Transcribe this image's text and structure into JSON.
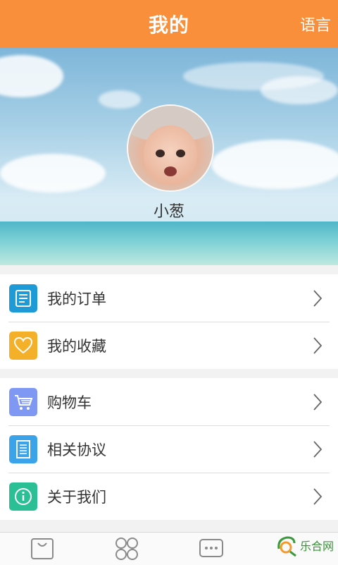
{
  "header": {
    "title": "我的",
    "language_label": "语言"
  },
  "profile": {
    "username": "小葱"
  },
  "menu_group_1": [
    {
      "label": "我的订单",
      "icon": "order-list-icon",
      "color": "#1e9bd7"
    },
    {
      "label": "我的收藏",
      "icon": "heart-icon",
      "color": "#f5b02a"
    }
  ],
  "menu_group_2": [
    {
      "label": "购物车",
      "icon": "cart-icon",
      "color": "#7f98f3"
    },
    {
      "label": "相关协议",
      "icon": "document-icon",
      "color": "#3aa3ea"
    },
    {
      "label": "关于我们",
      "icon": "info-icon",
      "color": "#2bbf96"
    }
  ],
  "tabbar": [
    {
      "name": "bag-icon"
    },
    {
      "name": "grid-icon"
    },
    {
      "name": "chat-icon"
    }
  ],
  "watermark": {
    "text": "乐合网"
  },
  "colors": {
    "accent": "#f98f3a"
  }
}
